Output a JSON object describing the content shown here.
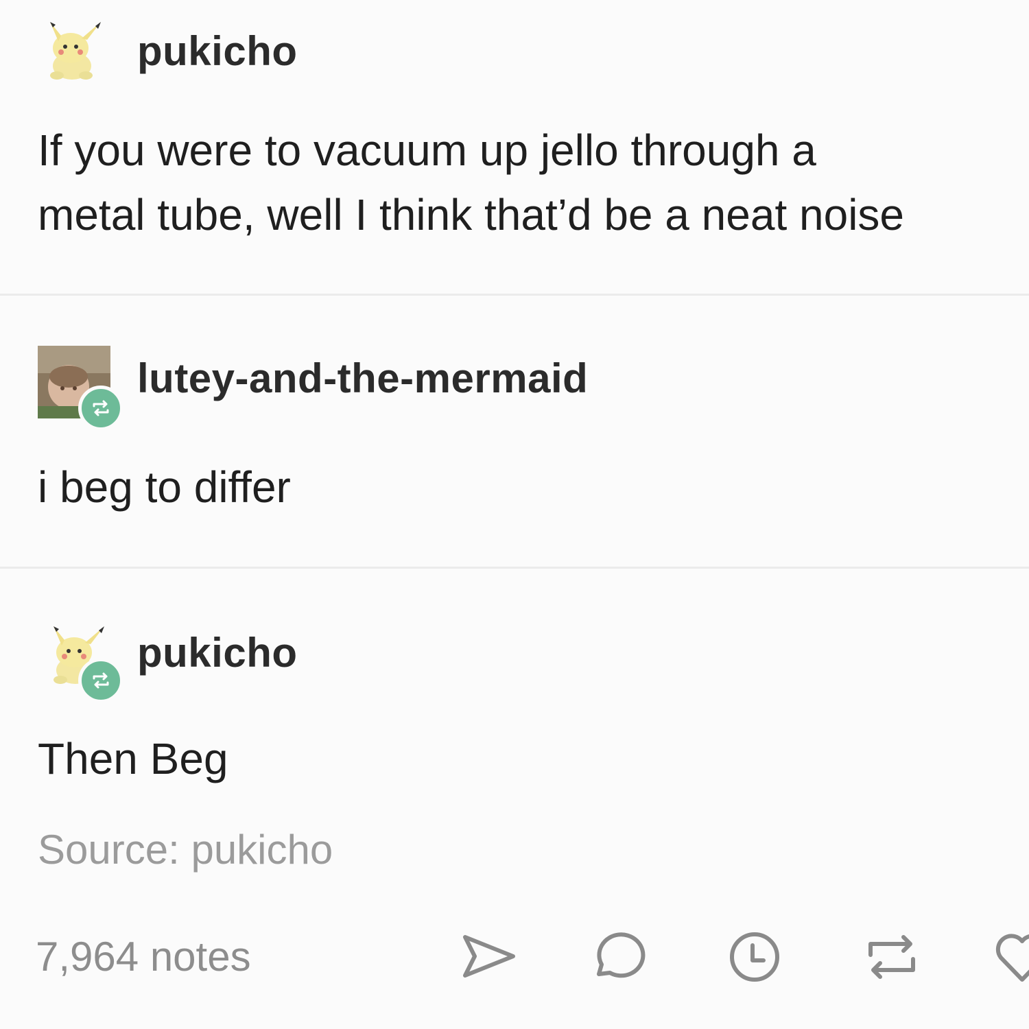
{
  "posts": [
    {
      "username": "pukicho",
      "text_lines": [
        "If you were to vacuum up jello through a",
        "metal tube, well I think that’d be a neat noise"
      ]
    },
    {
      "username": "lutey-and-the-mermaid",
      "text_lines": [
        "i beg to differ"
      ]
    },
    {
      "username": "pukicho",
      "text_lines": [
        "Then Beg"
      ]
    }
  ],
  "source": {
    "text": "Source: pukicho"
  },
  "footer": {
    "notes": "7,964 notes",
    "actions": [
      "share-icon",
      "reply-icon",
      "queue-icon",
      "reblog-icon",
      "like-icon"
    ]
  },
  "colors": {
    "background": "#fbfbfb",
    "reblog_badge": "#6dbb98",
    "divider": "#ebebeb",
    "muted_text": "#9b9b9b"
  }
}
